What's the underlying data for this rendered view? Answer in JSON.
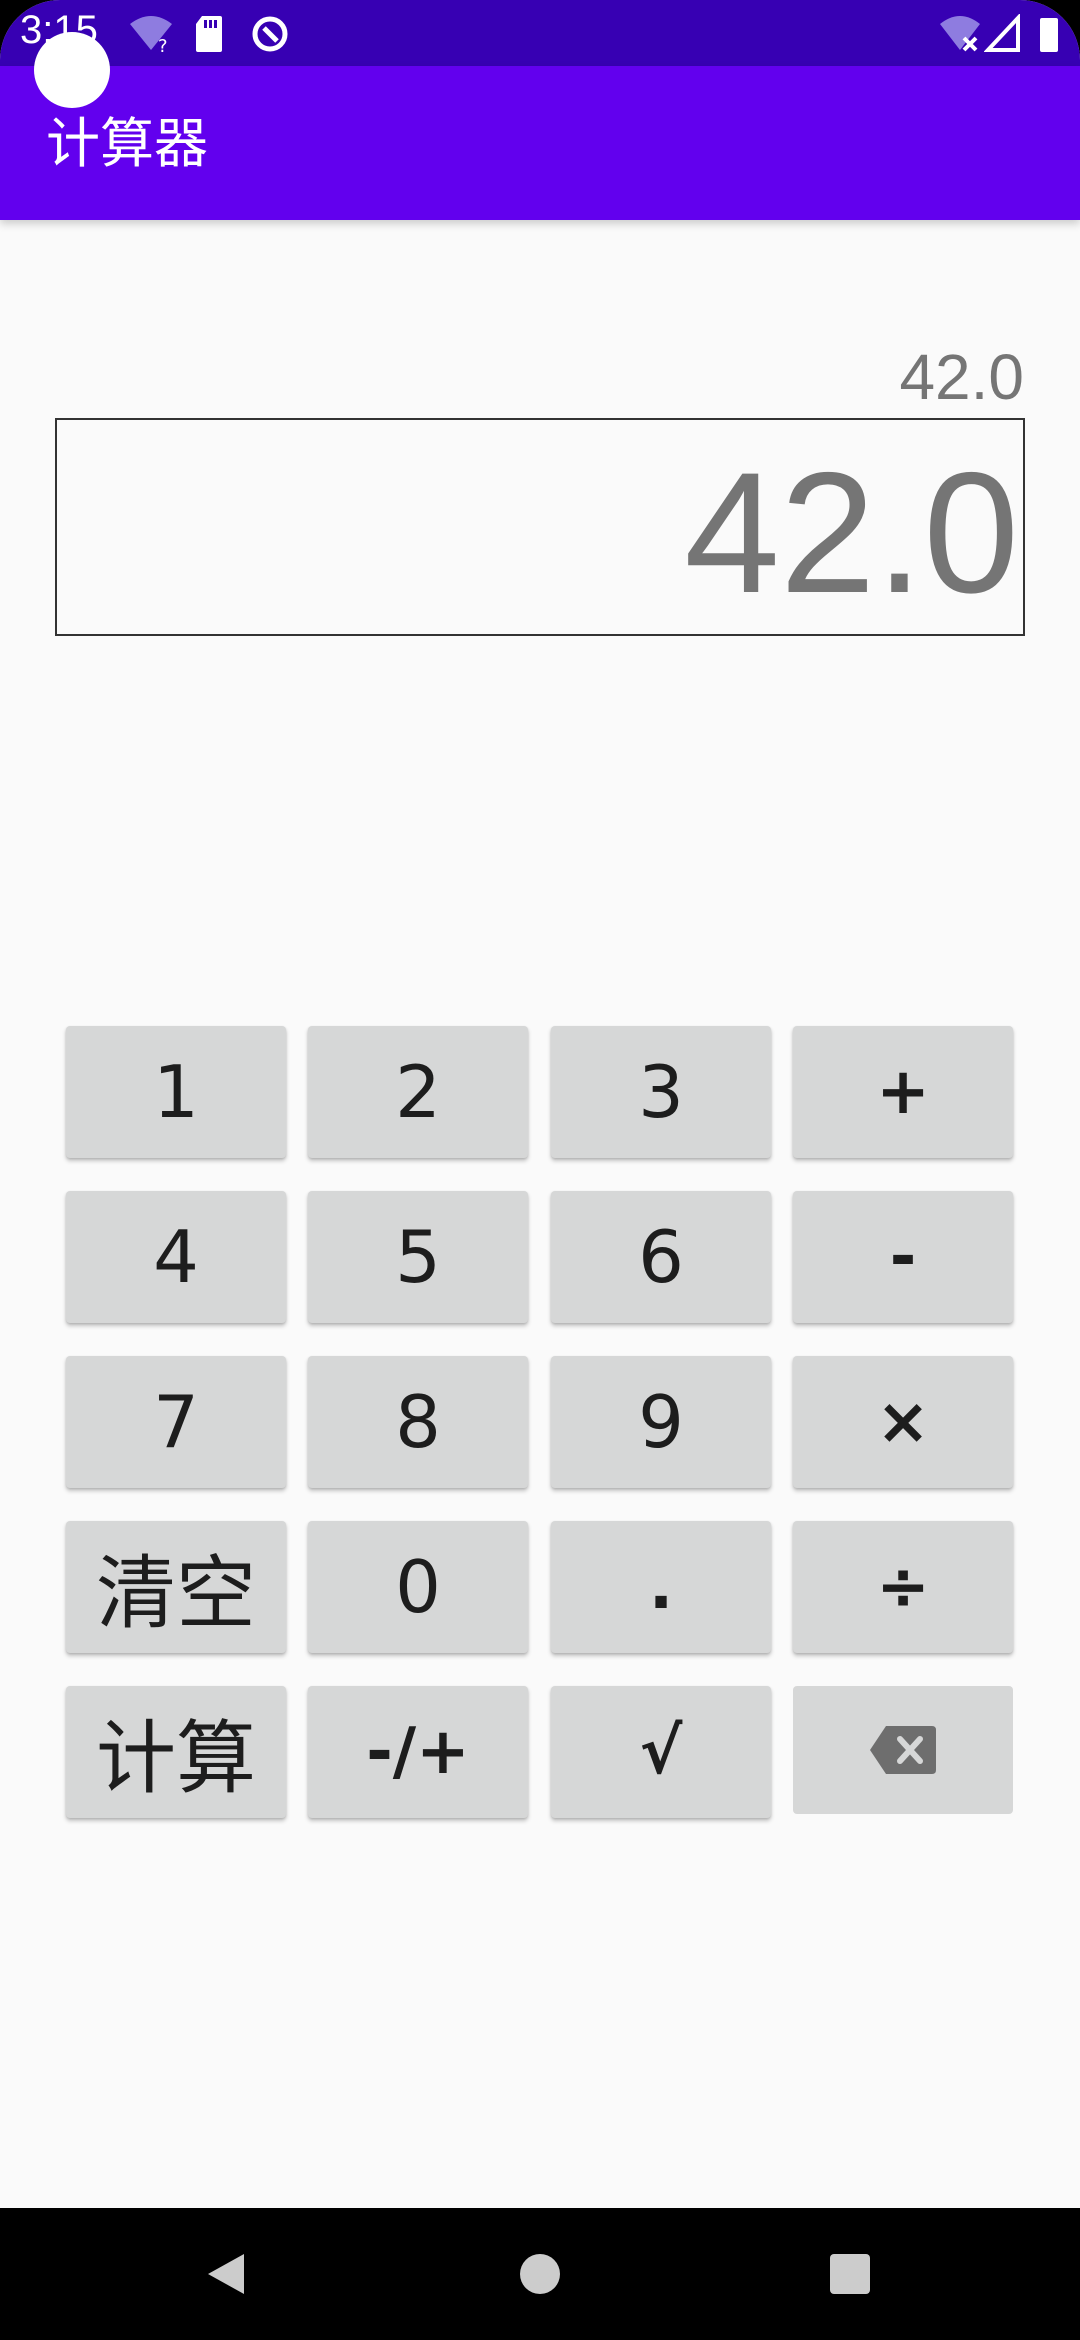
{
  "status_bar": {
    "time": "3:15",
    "colors": {
      "background": "#3700B3"
    }
  },
  "app_bar": {
    "title": "计算器",
    "colors": {
      "background": "#6200EE",
      "text": "#FFFFFF"
    }
  },
  "display": {
    "expression": "42.0",
    "result": "42.0"
  },
  "keypad": {
    "rows": [
      [
        "1",
        "2",
        "3",
        "+"
      ],
      [
        "4",
        "5",
        "6",
        "-"
      ],
      [
        "7",
        "8",
        "9",
        "×"
      ],
      [
        "清空",
        "0",
        ".",
        "÷"
      ],
      [
        "计算",
        "-/+",
        "√",
        "backspace-icon"
      ]
    ],
    "labels": {
      "k1": "1",
      "k2": "2",
      "k3": "3",
      "plus": "+",
      "k4": "4",
      "k5": "5",
      "k6": "6",
      "minus": "-",
      "k7": "7",
      "k8": "8",
      "k9": "9",
      "multiply": "×",
      "clear": "清空",
      "k0": "0",
      "dot": ".",
      "divide": "÷",
      "calculate": "计算",
      "negate": "-/+",
      "sqrt": "√"
    },
    "colors": {
      "key_background": "#D6D7D7",
      "key_text": "#1D1D1D"
    }
  },
  "icons": {
    "status": [
      "wifi-question-icon",
      "sd-card-icon",
      "sync-icon",
      "wifi-off-icon",
      "signal-icon",
      "battery-icon"
    ],
    "nav": [
      "back-icon",
      "home-icon",
      "recents-icon"
    ]
  }
}
